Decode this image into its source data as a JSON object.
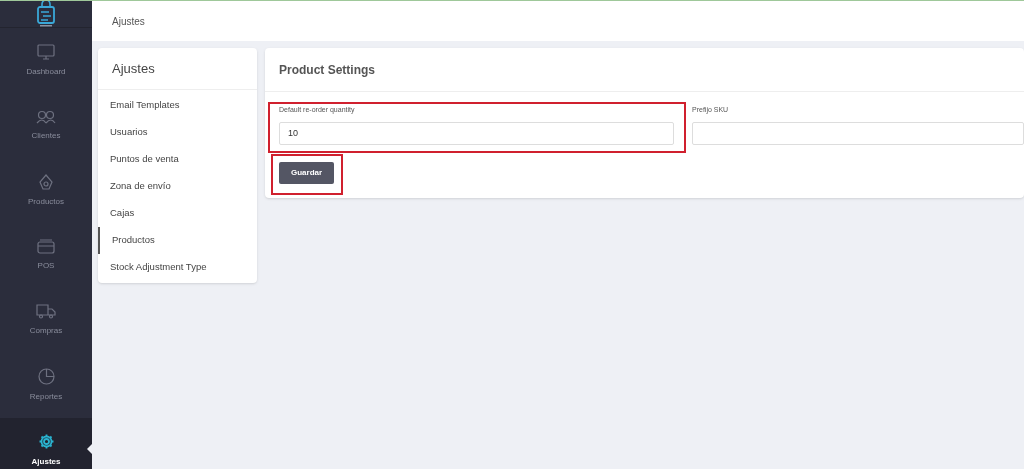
{
  "sidebar": {
    "items": [
      {
        "label": "Dashboard",
        "selected": false
      },
      {
        "label": "Clientes",
        "selected": false
      },
      {
        "label": "Productos",
        "selected": false
      },
      {
        "label": "POS",
        "selected": false
      },
      {
        "label": "Compras",
        "selected": false
      },
      {
        "label": "Reportes",
        "selected": false
      },
      {
        "label": "Ajustes",
        "selected": true
      }
    ]
  },
  "topbar": {
    "title": "Ajustes"
  },
  "settings_menu": {
    "title": "Ajustes",
    "items": [
      {
        "label": "Email Templates",
        "selected": false
      },
      {
        "label": "Usuarios",
        "selected": false
      },
      {
        "label": "Puntos de venta",
        "selected": false
      },
      {
        "label": "Zona de envío",
        "selected": false
      },
      {
        "label": "Cajas",
        "selected": false
      },
      {
        "label": "Productos",
        "selected": true
      },
      {
        "label": "Stock Adjustment Type",
        "selected": false
      }
    ]
  },
  "product_settings": {
    "title": "Product Settings",
    "fields": [
      {
        "label": "Default re-order quantity",
        "value": "10",
        "highlighted": true
      },
      {
        "label": "Prefijo SKU",
        "highlighted": false
      }
    ],
    "save_button": {
      "label": "Guardar",
      "highlighted": true
    }
  }
}
